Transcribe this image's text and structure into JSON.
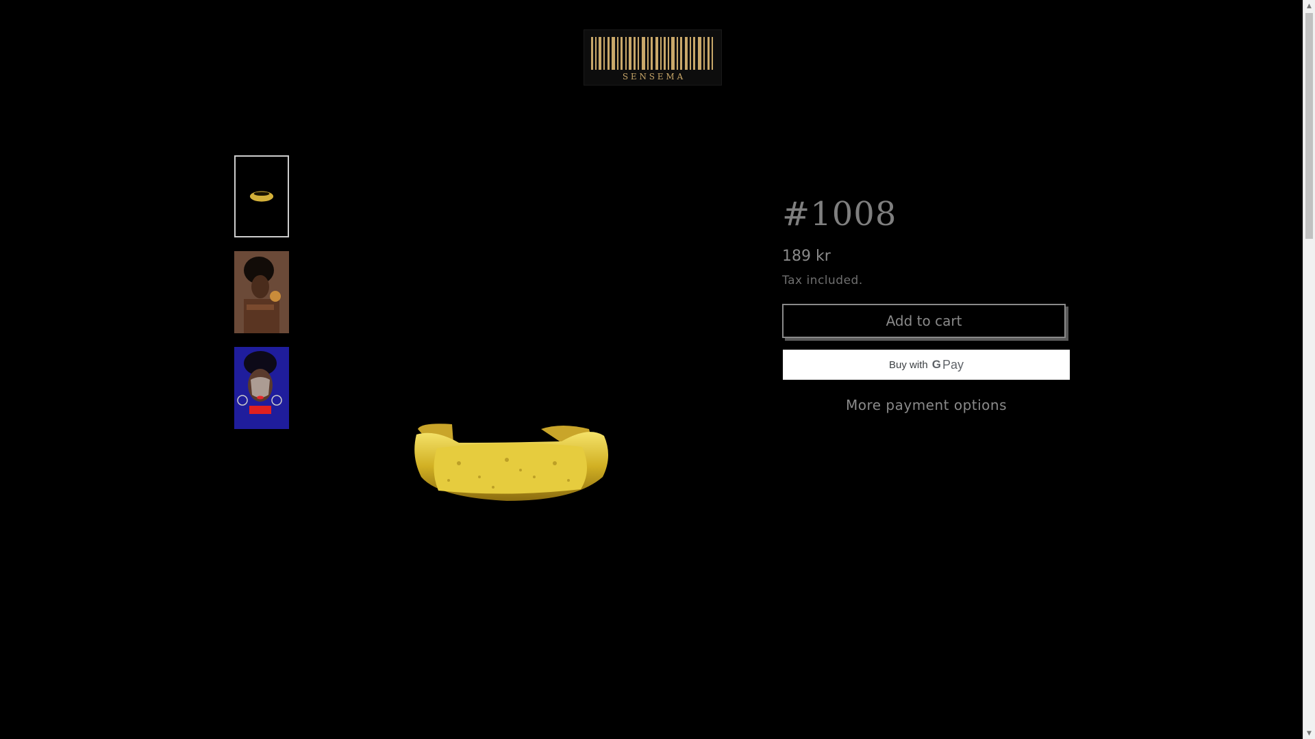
{
  "logo": {
    "text": "S E N S E M A"
  },
  "thumbnails": [
    {
      "label": "Gold ring thumbnail",
      "active": true
    },
    {
      "label": "Model with earrings thumbnail",
      "active": false
    },
    {
      "label": "Model with face paint thumbnail",
      "active": false
    }
  ],
  "product": {
    "title": "#1008",
    "price": "189 kr",
    "tax_note": "Tax included."
  },
  "actions": {
    "add_to_cart": "Add to cart",
    "buy_with": "Buy with",
    "gpay_g": "G",
    "gpay_pay": "Pay",
    "more_payment": "More payment options"
  },
  "colors": {
    "background": "#000000",
    "gold": "#d4b13a",
    "text": "#8a8a8a"
  }
}
